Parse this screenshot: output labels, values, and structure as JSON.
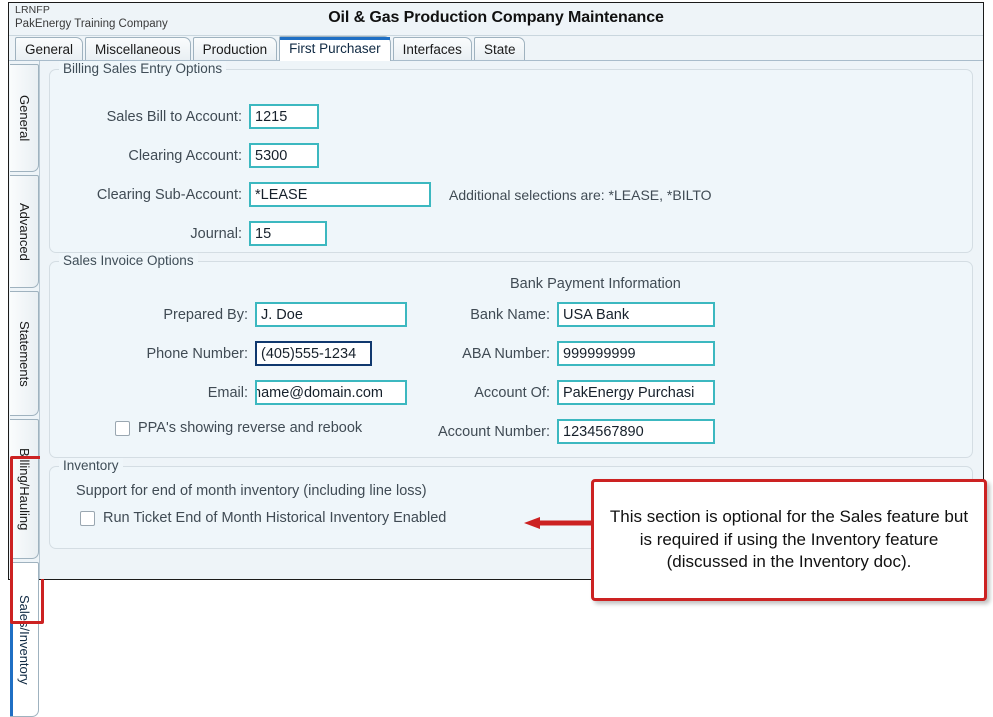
{
  "window": {
    "company_code": "LRNFP",
    "company_name": "PakEnergy Training Company",
    "title": "Oil & Gas Production Company Maintenance"
  },
  "top_tabs": [
    {
      "label": "General",
      "selected": false
    },
    {
      "label": "Miscellaneous",
      "selected": false
    },
    {
      "label": "Production",
      "selected": false
    },
    {
      "label": "First Purchaser",
      "selected": true
    },
    {
      "label": "Interfaces",
      "selected": false
    },
    {
      "label": "State",
      "selected": false
    }
  ],
  "side_tabs": [
    {
      "label": "General",
      "selected": false
    },
    {
      "label": "Advanced",
      "selected": false
    },
    {
      "label": "Statements",
      "selected": false
    },
    {
      "label": "Billing/Hauling",
      "selected": false
    },
    {
      "label": "Sales/Inventory",
      "selected": true
    }
  ],
  "billing_group": {
    "legend": "Billing Sales Entry Options",
    "sales_bill_to_account_label": "Sales Bill to Account:",
    "sales_bill_to_account_value": "1215",
    "clearing_account_label": "Clearing Account:",
    "clearing_account_value": "5300",
    "clearing_sub_account_label": "Clearing Sub-Account:",
    "clearing_sub_account_value": "*LEASE",
    "clearing_sub_account_note": "Additional selections are: *LEASE, *BILTO",
    "journal_label": "Journal:",
    "journal_value": "15"
  },
  "sales_group": {
    "legend": "Sales Invoice Options",
    "prepared_by_label": "Prepared By:",
    "prepared_by_value": "J. Doe",
    "phone_number_label": "Phone Number:",
    "phone_number_value": "(405)555-1234",
    "email_label": "Email:",
    "email_value": "name@domain.com",
    "ppa_checkbox_label": "PPA's showing reverse and rebook",
    "bank_heading": "Bank Payment Information",
    "bank_name_label": "Bank Name:",
    "bank_name_value": "USA Bank",
    "aba_number_label": "ABA Number:",
    "aba_number_value": "999999999",
    "account_of_label": "Account Of:",
    "account_of_value": "PakEnergy Purchasi",
    "account_number_label": "Account Number:",
    "account_number_value": "1234567890"
  },
  "inventory_group": {
    "legend": "Inventory",
    "support_text": "Support for end of month inventory (including line loss)",
    "run_ticket_checkbox_label": "Run Ticket End of Month Historical Inventory Enabled"
  },
  "annotation": {
    "callout_text": "This section is optional for the Sales feature but is required if using the Inventory feature (discussed in the Inventory doc)."
  },
  "colors": {
    "accent_blue": "#1f6fc4",
    "field_border_teal": "#3cb8c0",
    "field_border_focus": "#10386e",
    "annotation_red": "#cc2222",
    "panel_background": "#eff6fa"
  }
}
